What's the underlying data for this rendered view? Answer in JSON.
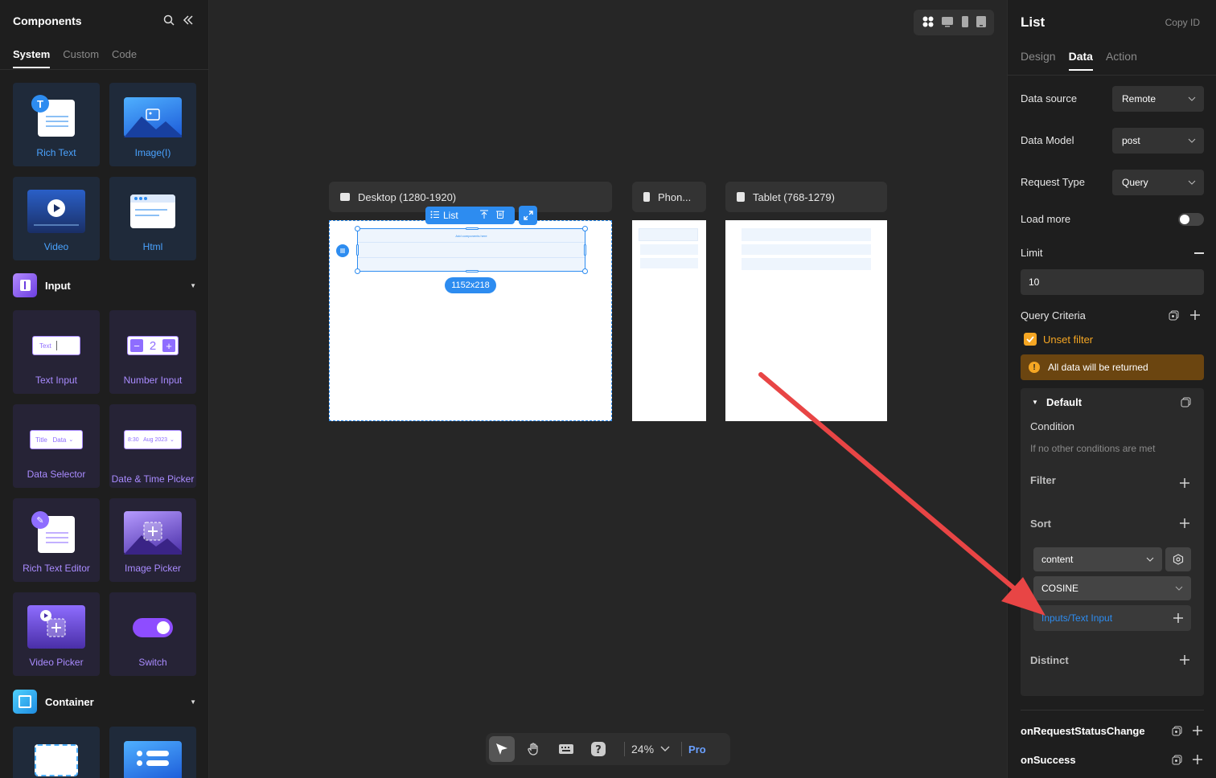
{
  "left_panel": {
    "title": "Components",
    "tabs": [
      "System",
      "Custom",
      "Code"
    ],
    "active_tab": "System",
    "top_cards": [
      {
        "label": "Rich Text",
        "icon": "rich-text-icon"
      },
      {
        "label": "Image(I)",
        "icon": "image-icon"
      },
      {
        "label": "Video",
        "icon": "video-icon"
      },
      {
        "label": "Html",
        "icon": "html-icon"
      }
    ],
    "input_section": {
      "title": "Input",
      "cards": [
        {
          "label": "Text Input",
          "thumb_text": "Text"
        },
        {
          "label": "Number Input",
          "thumb_text": "2"
        },
        {
          "label": "Data Selector",
          "thumb_text": "Title   Data"
        },
        {
          "label": "Date & Time Picker",
          "thumb_text": "8:30   Aug 2023"
        },
        {
          "label": "Rich Text Editor",
          "thumb_text": ""
        },
        {
          "label": "Image Picker",
          "thumb_text": ""
        },
        {
          "label": "Video Picker",
          "thumb_text": ""
        },
        {
          "label": "Switch",
          "thumb_text": ""
        }
      ]
    },
    "container_section": {
      "title": "Container"
    }
  },
  "canvas": {
    "frames": [
      {
        "label": "Desktop (1280-1920)"
      },
      {
        "label": "Phon..."
      },
      {
        "label": "Tablet (768-1279)"
      }
    ],
    "selected_component": "List",
    "size_badge": "1152x218",
    "placeholder_text": "Add components here",
    "zoom": "24%",
    "pro_label": "Pro"
  },
  "right_panel": {
    "title": "List",
    "copy_id": "Copy ID",
    "tabs": [
      "Design",
      "Data",
      "Action"
    ],
    "active_tab": "Data",
    "data_source": {
      "label": "Data source",
      "value": "Remote"
    },
    "data_model": {
      "label": "Data Model",
      "value": "post"
    },
    "request_type": {
      "label": "Request Type",
      "value": "Query"
    },
    "load_more": {
      "label": "Load more",
      "enabled": false
    },
    "limit": {
      "label": "Limit",
      "value": "10"
    },
    "query_criteria": {
      "label": "Query Criteria"
    },
    "unset_filter": {
      "label": "Unset filter",
      "checked": true
    },
    "warning": {
      "icon": "!",
      "text": "All data will be returned"
    },
    "default_block": {
      "title": "Default",
      "condition_label": "Condition",
      "condition_text": "If no other conditions are met",
      "filter_label": "Filter",
      "sort_label": "Sort",
      "sort_field": "content",
      "sort_mode": "COSINE",
      "sort_input": "Inputs/Text Input",
      "distinct_label": "Distinct"
    },
    "events": [
      "onRequestStatusChange",
      "onSuccess"
    ]
  },
  "colors": {
    "accent_blue": "#2d8cf0",
    "warning_orange": "#f5a623",
    "arrow_red": "#e84545"
  }
}
